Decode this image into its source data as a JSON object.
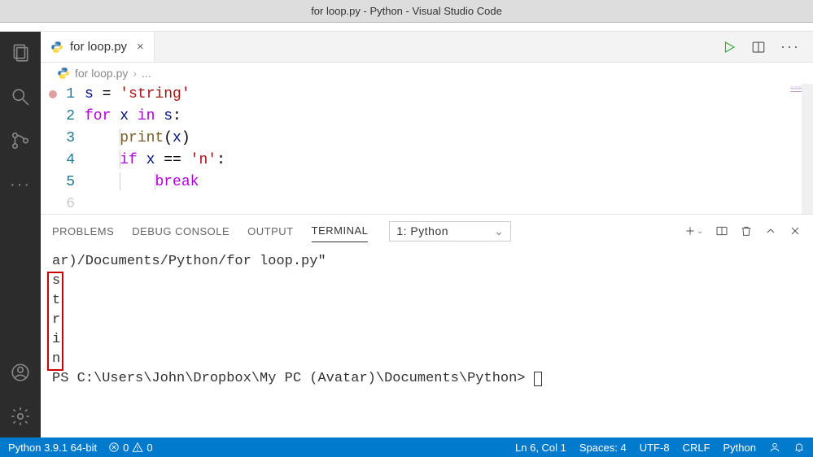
{
  "titlebar": {
    "title": "for loop.py - Python - Visual Studio Code"
  },
  "tab": {
    "filename": "for loop.py"
  },
  "breadcrumb": {
    "filename": "for loop.py",
    "more": "..."
  },
  "code": {
    "lines": [
      "1",
      "2",
      "3",
      "4",
      "5",
      "6"
    ],
    "l1_var": "s",
    "l1_eq": " = ",
    "l1_str": "'string'",
    "l2_for": "for",
    "l2_x": " x ",
    "l2_in": "in",
    "l2_s": " s",
    "l2_colon": ":",
    "l3_print": "print",
    "l3_open": "(",
    "l3_arg": "x",
    "l3_close": ")",
    "l4_if": "if",
    "l4_x": " x ",
    "l4_eq": "==",
    "l4_str": " 'n'",
    "l4_colon": ":",
    "l5_break": "break"
  },
  "panel": {
    "tabs": {
      "problems": "PROBLEMS",
      "debug": "DEBUG CONSOLE",
      "output": "OUTPUT",
      "terminal": "TERMINAL"
    },
    "terminal_select": "1: Python"
  },
  "terminal": {
    "line1": "ar)/Documents/Python/for loop.py\"",
    "out1": "s",
    "out2": "t",
    "out3": "r",
    "out4": "i",
    "out5": "n",
    "prompt": "PS C:\\Users\\John\\Dropbox\\My PC (Avatar)\\Documents\\Python> "
  },
  "statusbar": {
    "interpreter": "Python 3.9.1 64-bit",
    "errors": "0",
    "warnings": "0",
    "lncol": "Ln 6, Col 1",
    "spaces": "Spaces: 4",
    "encoding": "UTF-8",
    "eol": "CRLF",
    "lang": "Python"
  }
}
